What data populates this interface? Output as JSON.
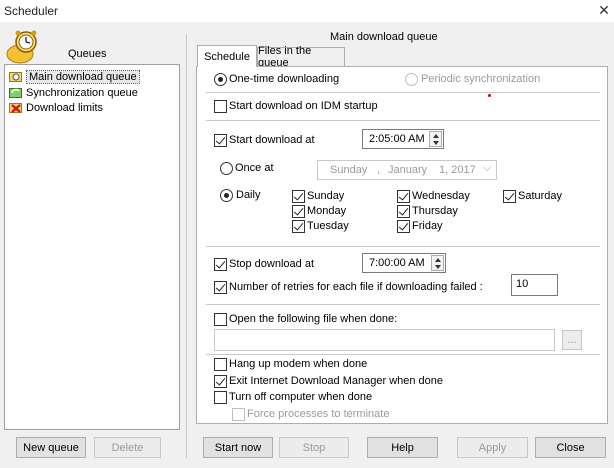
{
  "window": {
    "title": "Scheduler",
    "close_glyph": "✕"
  },
  "left": {
    "queues_label": "Queues",
    "items": [
      {
        "label": "Main download queue",
        "icon": "queue-main-icon"
      },
      {
        "label": "Synchronization queue",
        "icon": "queue-sync-icon"
      },
      {
        "label": "Download limits",
        "icon": "download-limits-icon"
      }
    ],
    "new_queue": "New queue",
    "delete": "Delete"
  },
  "right": {
    "title": "Main download queue",
    "tabs": [
      "Schedule",
      "Files in the queue"
    ],
    "mode": {
      "one_time": "One-time downloading",
      "periodic": "Periodic synchronization"
    },
    "start_on_startup": "Start download on IDM startup",
    "start_at": {
      "label": "Start download at",
      "time": "2:05:00 AM"
    },
    "once_at": {
      "label": "Once at",
      "day": "Sunday",
      "sep1": ",",
      "month": "January",
      "date": "1, 2017",
      "chevron": "⌵"
    },
    "daily": "Daily",
    "days": [
      "Sunday",
      "Monday",
      "Tuesday",
      "Wednesday",
      "Thursday",
      "Friday",
      "Saturday"
    ],
    "stop_at": {
      "label": "Stop download at",
      "time": "7:00:00 AM"
    },
    "retries": {
      "label": "Number of retries for each file if downloading failed :",
      "value": "10"
    },
    "open_file": {
      "label": "Open the following file when done:",
      "path": "",
      "browse": "..."
    },
    "hang_up": "Hang up modem when done",
    "exit_idm": "Exit Internet Download Manager when done",
    "turn_off": "Turn off computer when done",
    "force": "Force processes to terminate"
  },
  "buttons": {
    "start_now": "Start now",
    "stop": "Stop",
    "help": "Help",
    "apply": "Apply",
    "close": "Close"
  }
}
